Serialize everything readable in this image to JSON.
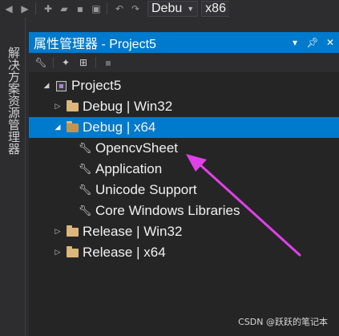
{
  "toolbar": {
    "config_dropdown": "Debu",
    "platform_dropdown": "x86"
  },
  "side_tab": {
    "label": "解决方案资源管理器"
  },
  "panel": {
    "title": "属性管理器 - Project5"
  },
  "tree": {
    "root": "Project5",
    "nodes": [
      {
        "label": "Debug | Win32",
        "expanded": false,
        "selected": false
      },
      {
        "label": "Debug | x64",
        "expanded": true,
        "selected": true
      },
      {
        "label": "Release | Win32",
        "expanded": false,
        "selected": false
      },
      {
        "label": "Release | x64",
        "expanded": false,
        "selected": false
      }
    ],
    "property_sheets": [
      "OpencvSheet",
      "Application",
      "Unicode Support",
      "Core Windows Libraries"
    ]
  },
  "annotation": {
    "arrow_color": "#e040e8"
  },
  "watermark": "CSDN @跃跃的笔记本",
  "icons": [
    "back-icon",
    "forward-icon",
    "new-item-icon",
    "open-folder-icon",
    "save-icon",
    "save-all-icon",
    "undo-icon",
    "redo-icon",
    "pin-icon",
    "close-icon",
    "wrench-icon",
    "add-property-sheet-icon",
    "add-existing-icon",
    "save-sheet-icon"
  ],
  "colors": {
    "accent": "#007acc",
    "background": "#252526",
    "folder": "#dcb67a"
  }
}
